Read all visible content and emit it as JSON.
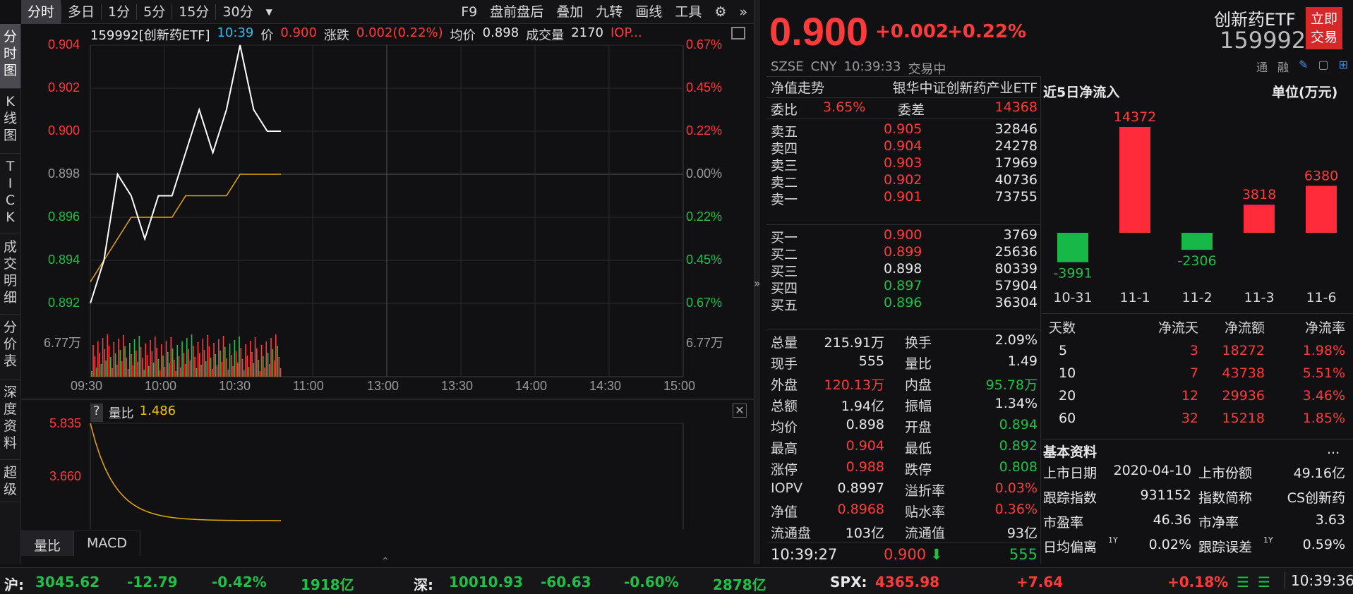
{
  "toolbar": {
    "items": [
      "分时",
      "多日",
      "1分",
      "5分",
      "15分",
      "30分"
    ],
    "right_items": [
      "F9",
      "盘前盘后",
      "叠加",
      "九转",
      "画线",
      "工具"
    ]
  },
  "side_tabs": [
    "分时图",
    "K线图",
    "TICK",
    "成交明细",
    "分价表",
    "深度资料",
    "超级"
  ],
  "chart_info": {
    "code": "159992[创新药ETF]",
    "time": "10:39",
    "price_label": "价",
    "price": "0.900",
    "change_label": "涨跌",
    "change": "0.002(0.22%)",
    "avg_label": "均价",
    "avg": "0.898",
    "vol_label": "成交量",
    "vol": "2170",
    "iopv": "IOP..."
  },
  "y_left": [
    "0.904",
    "0.902",
    "0.900",
    "0.898",
    "0.896",
    "0.894",
    "0.892"
  ],
  "y_right": [
    "0.67%",
    "0.45%",
    "0.22%",
    "0.00%",
    "0.22%",
    "0.45%",
    "0.67%"
  ],
  "vol_label_left": "6.77万",
  "vol_label_right": "6.77万",
  "x_times": [
    "09:30",
    "10:00",
    "10:30",
    "11:00",
    "13:00",
    "13:30",
    "14:00",
    "14:30",
    "15:00"
  ],
  "sub": {
    "label": "量比",
    "value": "1.486",
    "y_top": "5.835",
    "y_mid": "3.660",
    "q": "?"
  },
  "sub_tabs": [
    "量比",
    "MACD"
  ],
  "quote": {
    "price": "0.900",
    "change": "+0.002",
    "pct": "+0.22%",
    "market": "SZSE",
    "currency": "CNY",
    "time": "10:39:33",
    "status": "交易中",
    "name": "创新药ETF",
    "code": "159992",
    "trade_btn": "立即交易",
    "tong": "通",
    "rong": "融"
  },
  "nav": {
    "label": "净值走势",
    "fund_name": "银华中证创新药产业ETF"
  },
  "weibi": {
    "l1": "委比",
    "v1": "3.65%",
    "l2": "委差",
    "v2": "14368"
  },
  "asks": [
    {
      "l": "卖五",
      "p": "0.905",
      "v": "32846"
    },
    {
      "l": "卖四",
      "p": "0.904",
      "v": "24278"
    },
    {
      "l": "卖三",
      "p": "0.903",
      "v": "17969"
    },
    {
      "l": "卖二",
      "p": "0.902",
      "v": "40736"
    },
    {
      "l": "卖一",
      "p": "0.901",
      "v": "73755"
    }
  ],
  "bids": [
    {
      "l": "买一",
      "p": "0.900",
      "v": "3769",
      "c": "up"
    },
    {
      "l": "买二",
      "p": "0.899",
      "v": "25636",
      "c": "up"
    },
    {
      "l": "买三",
      "p": "0.898",
      "v": "80339",
      "c": "wh"
    },
    {
      "l": "买四",
      "p": "0.897",
      "v": "57904",
      "c": "dn"
    },
    {
      "l": "买五",
      "p": "0.896",
      "v": "36304",
      "c": "dn"
    }
  ],
  "stats": [
    {
      "l1": "总量",
      "v1": "215.91万",
      "c1": "wh",
      "l2": "换手",
      "v2": "2.09%",
      "c2": "wh"
    },
    {
      "l1": "现手",
      "v1": "555",
      "c1": "wh",
      "l2": "量比",
      "v2": "1.49",
      "c2": "wh"
    },
    {
      "l1": "外盘",
      "v1": "120.13万",
      "c1": "up",
      "l2": "内盘",
      "v2": "95.78万",
      "c2": "dn"
    },
    {
      "l1": "总额",
      "v1": "1.94亿",
      "c1": "wh",
      "l2": "振幅",
      "v2": "1.34%",
      "c2": "wh"
    },
    {
      "l1": "均价",
      "v1": "0.898",
      "c1": "wh",
      "l2": "开盘",
      "v2": "0.894",
      "c2": "dn"
    },
    {
      "l1": "最高",
      "v1": "0.904",
      "c1": "up",
      "l2": "最低",
      "v2": "0.892",
      "c2": "dn"
    },
    {
      "l1": "涨停",
      "v1": "0.988",
      "c1": "up",
      "l2": "跌停",
      "v2": "0.808",
      "c2": "dn"
    },
    {
      "l1": "IOPV",
      "v1": "0.8997",
      "c1": "wh",
      "l2": "溢折率",
      "v2": "0.03%",
      "c2": "up"
    },
    {
      "l1": "净值",
      "v1": "0.8968",
      "c1": "up",
      "l2": "贴水率",
      "v2": "0.36%",
      "c2": "up"
    },
    {
      "l1": "流通盘",
      "v1": "103亿",
      "c1": "wh",
      "l2": "流通值",
      "v2": "93亿",
      "c2": "wh"
    }
  ],
  "last_tick": {
    "time": "10:39:27",
    "price": "0.900",
    "vol": "555"
  },
  "flow": {
    "title": "近5日净流入",
    "unit": "单位(万元)",
    "headers": [
      "天数",
      "净流天",
      "净流额",
      "净流率"
    ],
    "rows": [
      {
        "d": "5",
        "n": "3",
        "a": "18272",
        "r": "1.98%"
      },
      {
        "d": "10",
        "n": "7",
        "a": "43738",
        "r": "5.51%"
      },
      {
        "d": "20",
        "n": "12",
        "a": "29936",
        "r": "3.46%"
      },
      {
        "d": "60",
        "n": "32",
        "a": "15218",
        "r": "1.85%"
      }
    ]
  },
  "chart_data": [
    {
      "type": "bar",
      "categories": [
        "10-31",
        "11-1",
        "11-2",
        "11-3",
        "11-6"
      ],
      "values": [
        -3991,
        14372,
        -2306,
        3818,
        6380
      ]
    },
    {
      "type": "line",
      "title": "",
      "x": [
        "09:30",
        "09:35",
        "09:40",
        "09:45",
        "09:50",
        "09:55",
        "10:00",
        "10:05",
        "10:10",
        "10:15",
        "10:20",
        "10:25",
        "10:30",
        "10:35",
        "10:39"
      ],
      "series": [
        {
          "values": [
            0.892,
            0.894,
            0.898,
            0.897,
            0.895,
            0.897,
            0.897,
            0.899,
            0.901,
            0.899,
            0.901,
            0.904,
            0.901,
            0.9,
            0.9
          ]
        },
        {
          "values": [
            0.893,
            0.894,
            0.895,
            0.896,
            0.896,
            0.896,
            0.896,
            0.897,
            0.897,
            0.897,
            0.897,
            0.898,
            0.898,
            0.898,
            0.898
          ]
        }
      ],
      "ylim": [
        0.892,
        0.904
      ]
    }
  ],
  "basic": {
    "title": "基本资料",
    "more": "...",
    "items": [
      {
        "l": "上市日期",
        "v": "2020-04-10"
      },
      {
        "l": "上市份额",
        "v": "49.16亿"
      },
      {
        "l": "跟踪指数",
        "v": "931152"
      },
      {
        "l": "指数简称",
        "v": "CS创新药"
      },
      {
        "l": "市盈率",
        "v": "46.36"
      },
      {
        "l": "市净率",
        "v": "3.63"
      },
      {
        "l": "日均偏离",
        "v": "0.02%"
      },
      {
        "l": "跟踪误差",
        "v": "0.59%"
      }
    ],
    "sup": "1Y"
  },
  "ticker": [
    {
      "l": "沪:",
      "p": "3045.62",
      "c": "-12.79",
      "pct": "-0.42%",
      "amt": "1918亿"
    },
    {
      "l": "深:",
      "p": "10010.93",
      "c": "-60.63",
      "pct": "-0.60%",
      "amt": "2878亿"
    },
    {
      "l": "SPX:",
      "p": "4365.98",
      "c": "+7.64",
      "pct": "+0.18%"
    }
  ],
  "clock": "10:39:36"
}
